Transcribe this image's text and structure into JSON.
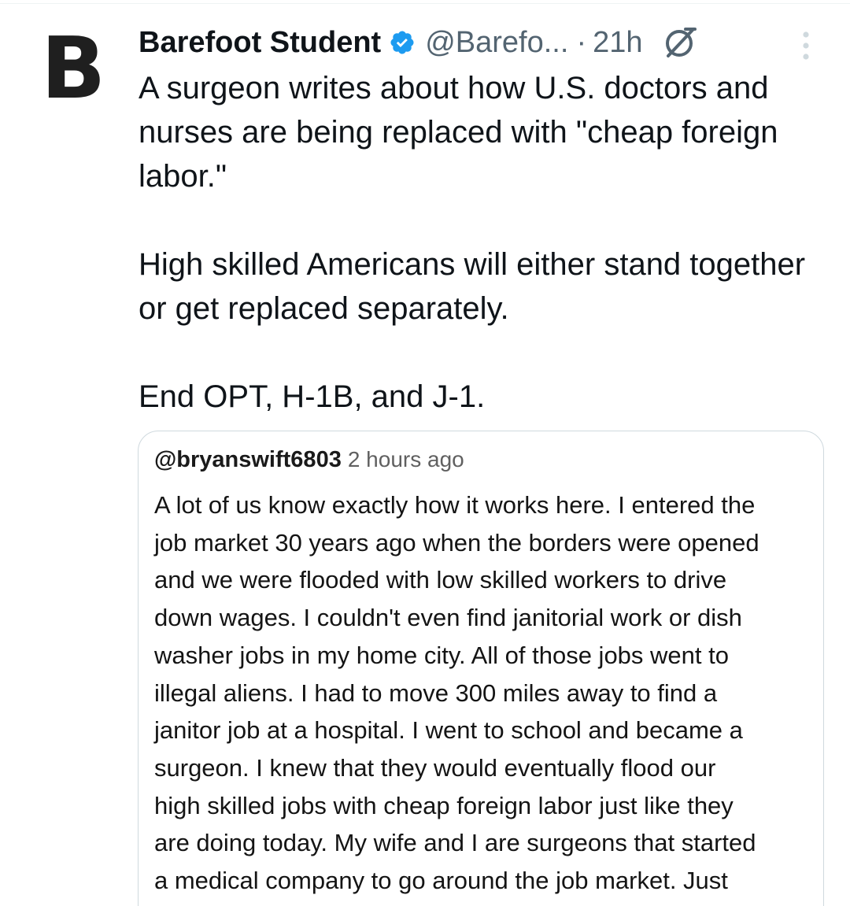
{
  "colors": {
    "verified_blue": "#1d9bf0",
    "secondary_text": "#536471",
    "primary_text": "#0f1419",
    "card_border": "#cfd9de"
  },
  "tweet": {
    "avatar_letter": "B",
    "author_name": "Barefoot Student",
    "verified_icon": "verified-badge-icon",
    "handle": "@Barefo...",
    "separator": "·",
    "time": "21h",
    "grok_icon": "grok-icon",
    "more_icon": "more-options-icon",
    "paragraphs": [
      "A surgeon writes about how U.S. doctors and nurses are being replaced with \"cheap foreign labor.\"",
      "High skilled Americans will either stand together or get replaced separately.",
      "End OPT, H-1B, and J-1."
    ]
  },
  "quoted_comment": {
    "handle": "@bryanswift6803",
    "time": "2 hours ago",
    "lines": [
      "A lot of us know exactly how it works here.  I entered the",
      "job market 30 years ago when the borders were opened",
      "and we were flooded with low skilled workers to drive",
      "down wages.  I couldn't even find janitorial work or dish",
      "washer jobs in my home city.  All of those jobs went to",
      "illegal aliens.  I had to move 300 miles away to find a",
      "janitor job at a hospital.  I went to school and became a",
      "surgeon.  I knew that they would eventually flood our",
      "high skilled jobs with cheap foreign labor just like they",
      "are doing today.  My wife and I are surgeons that started",
      "a medical company to go around the job market.  Just"
    ]
  }
}
